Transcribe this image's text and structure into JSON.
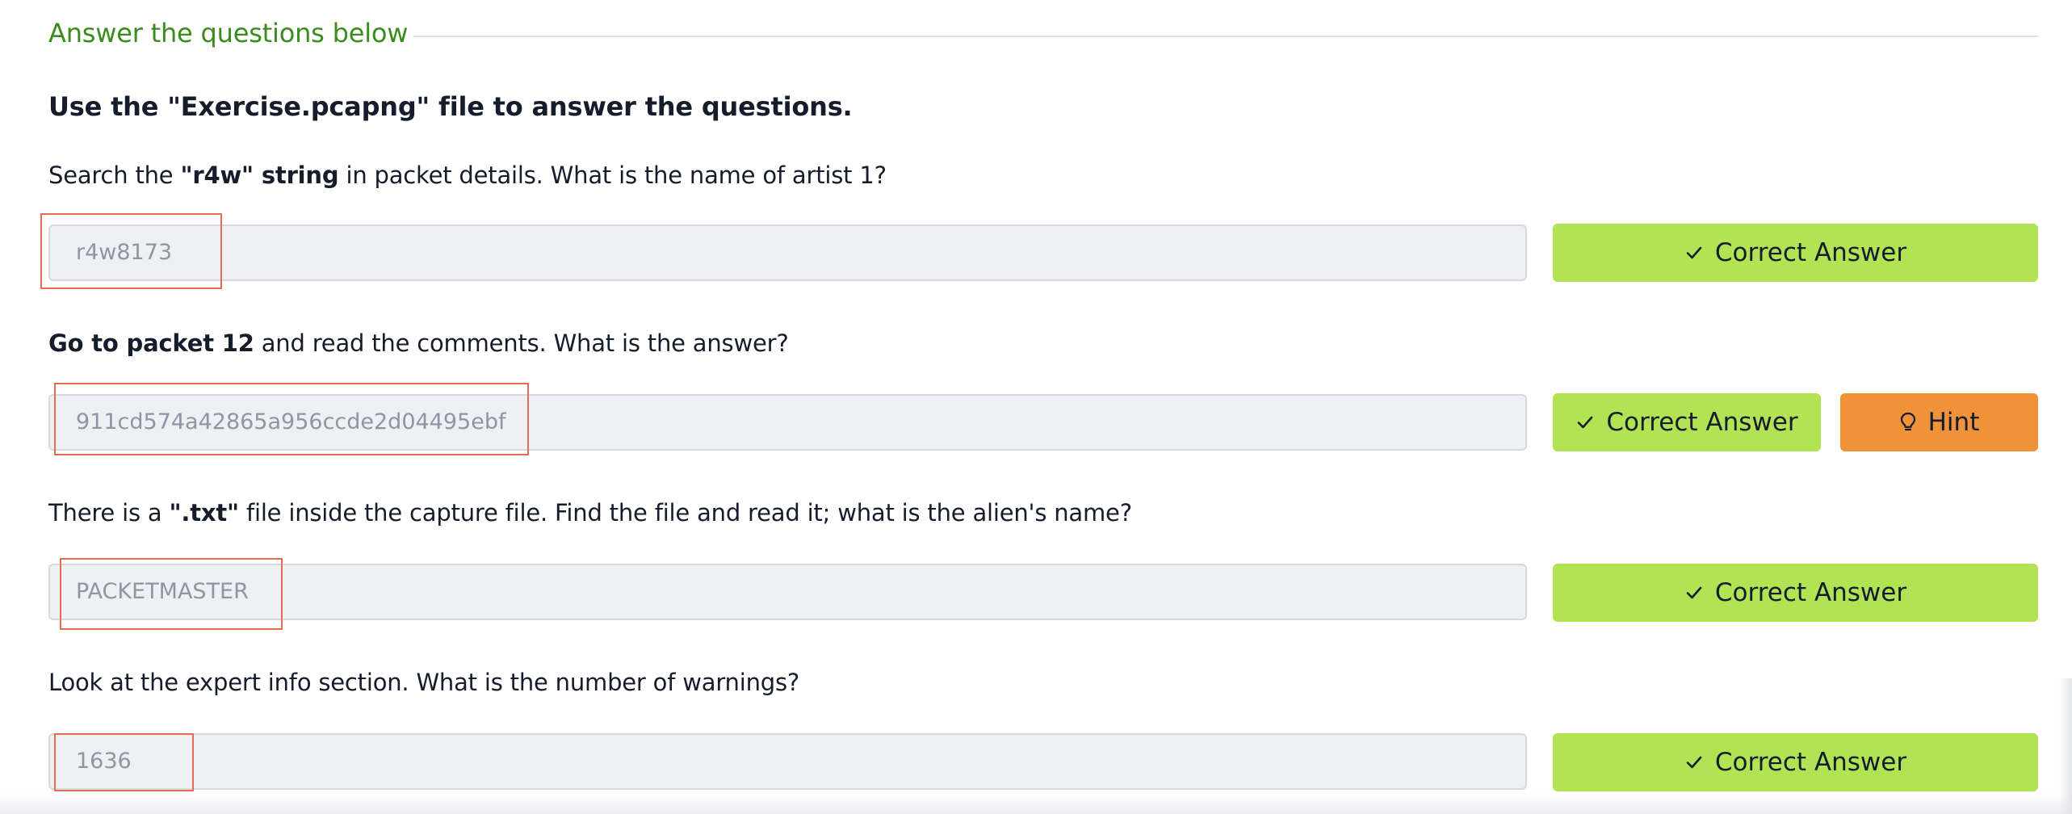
{
  "section": {
    "title": "Answer the questions below"
  },
  "intro": {
    "text": "Use the \"Exercise.pcapng\" file to answer the questions."
  },
  "colors": {
    "section_title": "#3a8d1d",
    "correct_button": "#b2e353",
    "hint_button": "#f0923a",
    "annotation_box": "#e56b55"
  },
  "icons": {
    "correct": "check-icon",
    "hint": "lightbulb-icon"
  },
  "questions": [
    {
      "pre": "Search the ",
      "bold": "\"r4w\" string",
      "post": " in packet details. What is the name of artist 1?",
      "answer": "r4w8173",
      "correct_label": "Correct Answer"
    },
    {
      "bold": "Go to packet 12",
      "post": " and read the comments. What is the answer?",
      "answer": "911cd574a42865a956ccde2d04495ebf",
      "correct_label": "Correct Answer",
      "hint_label": "Hint"
    },
    {
      "pre": "There is a ",
      "bold": "\".txt\"",
      "post": " file inside the capture file. Find the file and read it; what is the alien's name?",
      "answer": "PACKETMASTER",
      "correct_label": "Correct Answer"
    },
    {
      "text": "Look at the expert info section. What is the number of warnings?",
      "answer": "1636",
      "correct_label": "Correct Answer"
    }
  ]
}
